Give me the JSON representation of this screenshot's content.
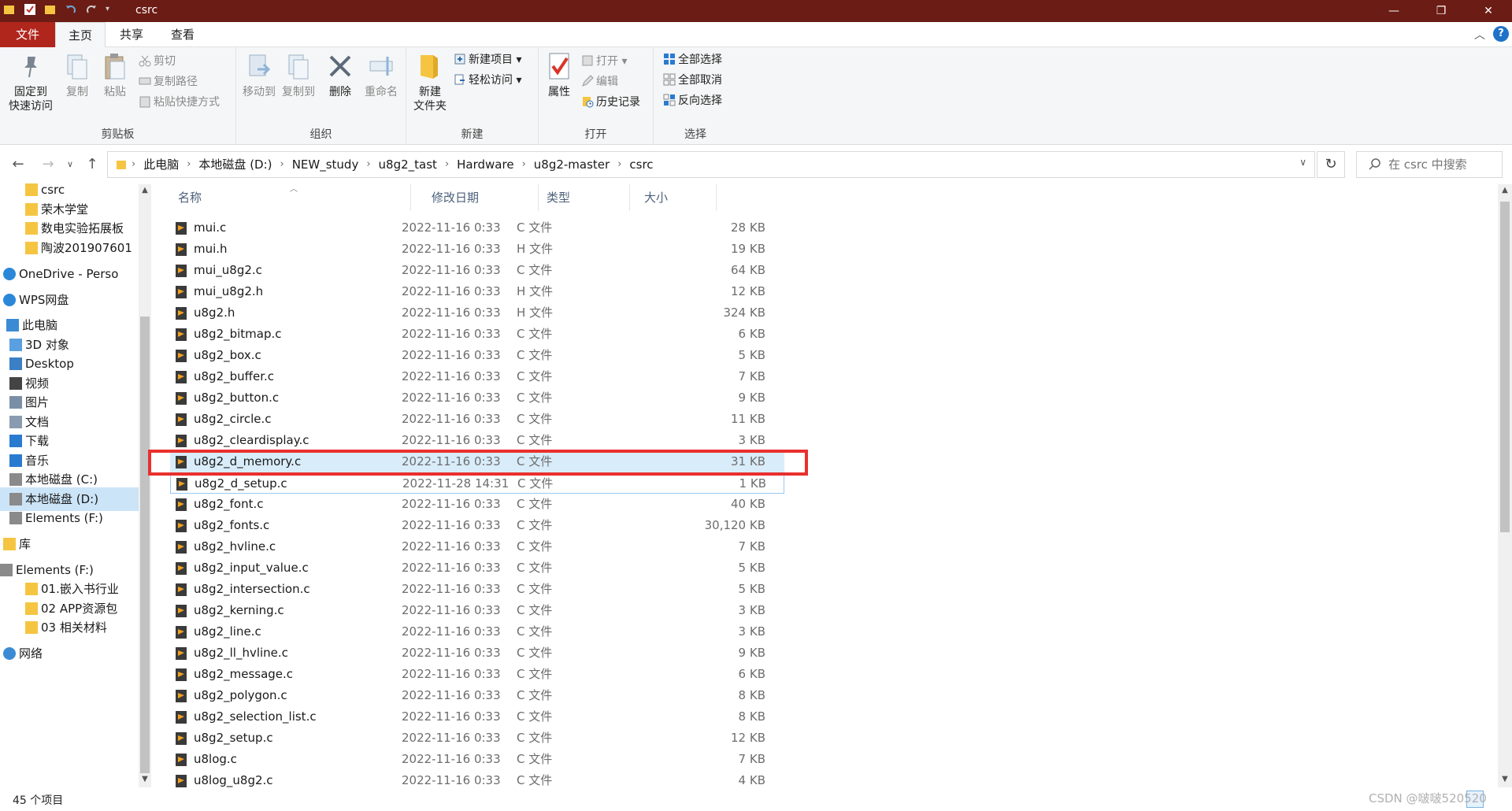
{
  "window": {
    "title": "csrc",
    "minimize": "—",
    "maximize": "❐",
    "close": "✕"
  },
  "tabs": {
    "file": "文件",
    "home": "主页",
    "share": "共享",
    "view": "查看"
  },
  "ribbon": {
    "clipboard": {
      "pin": "固定到\n快速访问",
      "pin_l1": "固定到",
      "pin_l2": "快速访问",
      "copy": "复制",
      "paste": "粘贴",
      "cut": "剪切",
      "copy_path": "复制路径",
      "paste_shortcut": "粘贴快捷方式",
      "label": "剪贴板"
    },
    "organize": {
      "move_to": "移动到",
      "copy_to": "复制到",
      "delete": "删除",
      "rename": "重命名",
      "label": "组织"
    },
    "new": {
      "new_folder_l1": "新建",
      "new_folder_l2": "文件夹",
      "new_item": "新建项目 ▾",
      "easy_access": "轻松访问 ▾",
      "label": "新建"
    },
    "open": {
      "properties": "属性",
      "open": "打开 ▾",
      "edit": "编辑",
      "history": "历史记录",
      "label": "打开"
    },
    "select": {
      "select_all": "全部选择",
      "select_none": "全部取消",
      "invert": "反向选择",
      "label": "选择"
    }
  },
  "address": {
    "crumbs": [
      "此电脑",
      "本地磁盘 (D:)",
      "NEW_study",
      "u8g2_tast",
      "Hardware",
      "u8g2-master",
      "csrc"
    ],
    "search_placeholder": "在 csrc 中搜索"
  },
  "nav": {
    "items": [
      {
        "label": "csrc",
        "icon": "folder-icon"
      },
      {
        "label": "荣木学堂",
        "icon": "folder-icon"
      },
      {
        "label": "数电实验拓展板",
        "icon": "folder-icon"
      },
      {
        "label": "陶波201907601",
        "icon": "folder-icon"
      },
      {
        "label": "OneDrive - Perso",
        "icon": "cloud-icon"
      },
      {
        "label": "WPS网盘",
        "icon": "cloud-icon"
      },
      {
        "label": "此电脑",
        "icon": "computer-icon"
      },
      {
        "label": "3D 对象",
        "icon": "cube-icon"
      },
      {
        "label": "Desktop",
        "icon": "desktop-icon"
      },
      {
        "label": "视频",
        "icon": "video-icon"
      },
      {
        "label": "图片",
        "icon": "picture-icon"
      },
      {
        "label": "文档",
        "icon": "document-icon"
      },
      {
        "label": "下载",
        "icon": "download-icon"
      },
      {
        "label": "音乐",
        "icon": "music-icon"
      },
      {
        "label": "本地磁盘 (C:)",
        "icon": "drive-icon"
      },
      {
        "label": "本地磁盘 (D:)",
        "icon": "drive-icon"
      },
      {
        "label": "Elements (F:)",
        "icon": "drive-icon"
      },
      {
        "label": "库",
        "icon": "library-icon"
      },
      {
        "label": "Elements (F:)",
        "icon": "drive-icon"
      },
      {
        "label": "01.嵌入书行业",
        "icon": "folder-icon"
      },
      {
        "label": "02  APP资源包",
        "icon": "folder-icon"
      },
      {
        "label": "03  相关材料",
        "icon": "folder-icon"
      },
      {
        "label": "网络",
        "icon": "network-icon"
      }
    ]
  },
  "columns": {
    "name": "名称",
    "date": "修改日期",
    "type": "类型",
    "size": "大小"
  },
  "files": [
    {
      "name": "mui.c",
      "date": "2022-11-16 0:33",
      "type": "C 文件",
      "size": "28 KB"
    },
    {
      "name": "mui.h",
      "date": "2022-11-16 0:33",
      "type": "H 文件",
      "size": "19 KB"
    },
    {
      "name": "mui_u8g2.c",
      "date": "2022-11-16 0:33",
      "type": "C 文件",
      "size": "64 KB"
    },
    {
      "name": "mui_u8g2.h",
      "date": "2022-11-16 0:33",
      "type": "H 文件",
      "size": "12 KB"
    },
    {
      "name": "u8g2.h",
      "date": "2022-11-16 0:33",
      "type": "H 文件",
      "size": "324 KB"
    },
    {
      "name": "u8g2_bitmap.c",
      "date": "2022-11-16 0:33",
      "type": "C 文件",
      "size": "6 KB"
    },
    {
      "name": "u8g2_box.c",
      "date": "2022-11-16 0:33",
      "type": "C 文件",
      "size": "5 KB"
    },
    {
      "name": "u8g2_buffer.c",
      "date": "2022-11-16 0:33",
      "type": "C 文件",
      "size": "7 KB"
    },
    {
      "name": "u8g2_button.c",
      "date": "2022-11-16 0:33",
      "type": "C 文件",
      "size": "9 KB"
    },
    {
      "name": "u8g2_circle.c",
      "date": "2022-11-16 0:33",
      "type": "C 文件",
      "size": "11 KB"
    },
    {
      "name": "u8g2_cleardisplay.c",
      "date": "2022-11-16 0:33",
      "type": "C 文件",
      "size": "3 KB"
    },
    {
      "name": "u8g2_d_memory.c",
      "date": "2022-11-16 0:33",
      "type": "C 文件",
      "size": "31 KB"
    },
    {
      "name": "u8g2_d_setup.c",
      "date": "2022-11-28 14:31",
      "type": "C 文件",
      "size": "1 KB"
    },
    {
      "name": "u8g2_font.c",
      "date": "2022-11-16 0:33",
      "type": "C 文件",
      "size": "40 KB"
    },
    {
      "name": "u8g2_fonts.c",
      "date": "2022-11-16 0:33",
      "type": "C 文件",
      "size": "30,120 KB"
    },
    {
      "name": "u8g2_hvline.c",
      "date": "2022-11-16 0:33",
      "type": "C 文件",
      "size": "7 KB"
    },
    {
      "name": "u8g2_input_value.c",
      "date": "2022-11-16 0:33",
      "type": "C 文件",
      "size": "5 KB"
    },
    {
      "name": "u8g2_intersection.c",
      "date": "2022-11-16 0:33",
      "type": "C 文件",
      "size": "5 KB"
    },
    {
      "name": "u8g2_kerning.c",
      "date": "2022-11-16 0:33",
      "type": "C 文件",
      "size": "3 KB"
    },
    {
      "name": "u8g2_line.c",
      "date": "2022-11-16 0:33",
      "type": "C 文件",
      "size": "3 KB"
    },
    {
      "name": "u8g2_ll_hvline.c",
      "date": "2022-11-16 0:33",
      "type": "C 文件",
      "size": "9 KB"
    },
    {
      "name": "u8g2_message.c",
      "date": "2022-11-16 0:33",
      "type": "C 文件",
      "size": "6 KB"
    },
    {
      "name": "u8g2_polygon.c",
      "date": "2022-11-16 0:33",
      "type": "C 文件",
      "size": "8 KB"
    },
    {
      "name": "u8g2_selection_list.c",
      "date": "2022-11-16 0:33",
      "type": "C 文件",
      "size": "8 KB"
    },
    {
      "name": "u8g2_setup.c",
      "date": "2022-11-16 0:33",
      "type": "C 文件",
      "size": "12 KB"
    },
    {
      "name": "u8log.c",
      "date": "2022-11-16 0:33",
      "type": "C 文件",
      "size": "7 KB"
    },
    {
      "name": "u8log_u8g2.c",
      "date": "2022-11-16 0:33",
      "type": "C 文件",
      "size": "4 KB"
    }
  ],
  "status": {
    "count": "45 个项目"
  },
  "watermark": "CSDN @啵啵520520",
  "colors": {
    "titlebar": "#6b1c14",
    "file_tab": "#b0261c",
    "highlight_box": "#e8302e",
    "selection": "#cce4f7"
  }
}
